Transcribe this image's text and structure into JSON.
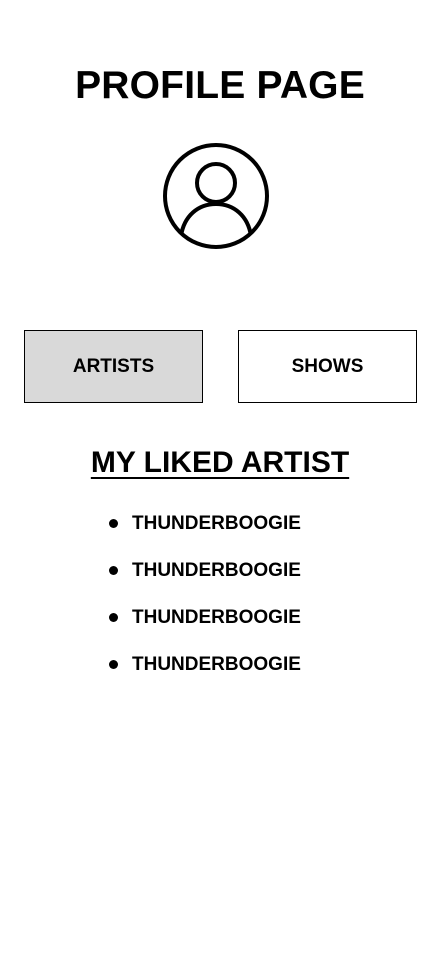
{
  "header": {
    "title": "PROFILE PAGE",
    "avatar_icon": "user-circle-icon"
  },
  "tabs": [
    {
      "label": "ARTISTS",
      "selected": true
    },
    {
      "label": "SHOWS",
      "selected": false
    }
  ],
  "liked_section": {
    "heading": "MY LIKED ARTIST",
    "items": [
      {
        "name": "THUNDERBOOGIE"
      },
      {
        "name": "THUNDERBOOGIE"
      },
      {
        "name": "THUNDERBOOGIE"
      },
      {
        "name": "THUNDERBOOGIE"
      }
    ]
  },
  "colors": {
    "selected_tab_bg": "#d9d9d9",
    "border": "#000000",
    "background": "#ffffff"
  }
}
